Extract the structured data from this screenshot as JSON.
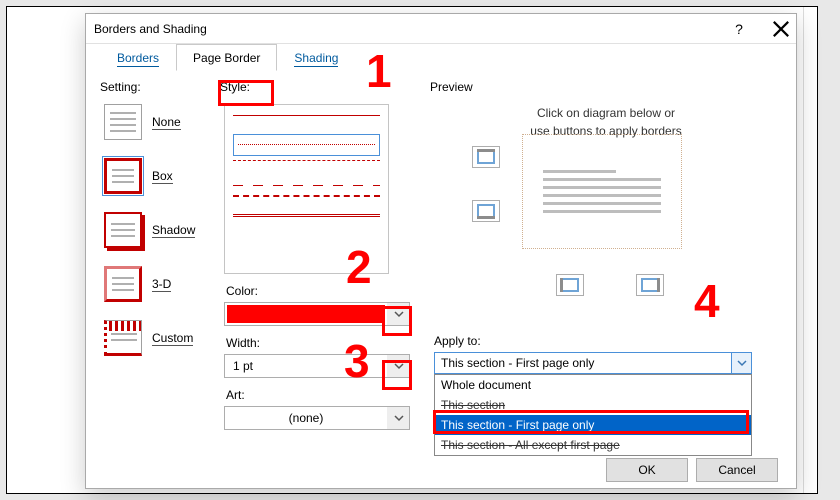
{
  "window": {
    "title": "Borders and Shading"
  },
  "tabs": {
    "borders": "Borders",
    "pageBorder": "Page Border",
    "shading": "Shading"
  },
  "setting": {
    "label": "Setting:",
    "none": "None",
    "box": "Box",
    "shadow": "Shadow",
    "three_d": "3-D",
    "custom": "Custom"
  },
  "style": {
    "label": "Style:",
    "colorLabel": "Color:",
    "widthLabel": "Width:",
    "widthValue": "1 pt",
    "artLabel": "Art:",
    "artValue": "(none)"
  },
  "preview": {
    "label": "Preview",
    "hint1": "Click on diagram below or",
    "hint2": "use buttons to apply borders"
  },
  "applyto": {
    "label": "Apply to:",
    "selected": "This section - First page only",
    "options": [
      "Whole document",
      "This section",
      "This section - First page only",
      "This section - All except first page"
    ]
  },
  "footer": {
    "ok": "OK",
    "cancel": "Cancel"
  },
  "callouts": {
    "n1": "1",
    "n2": "2",
    "n3": "3",
    "n4": "4"
  }
}
